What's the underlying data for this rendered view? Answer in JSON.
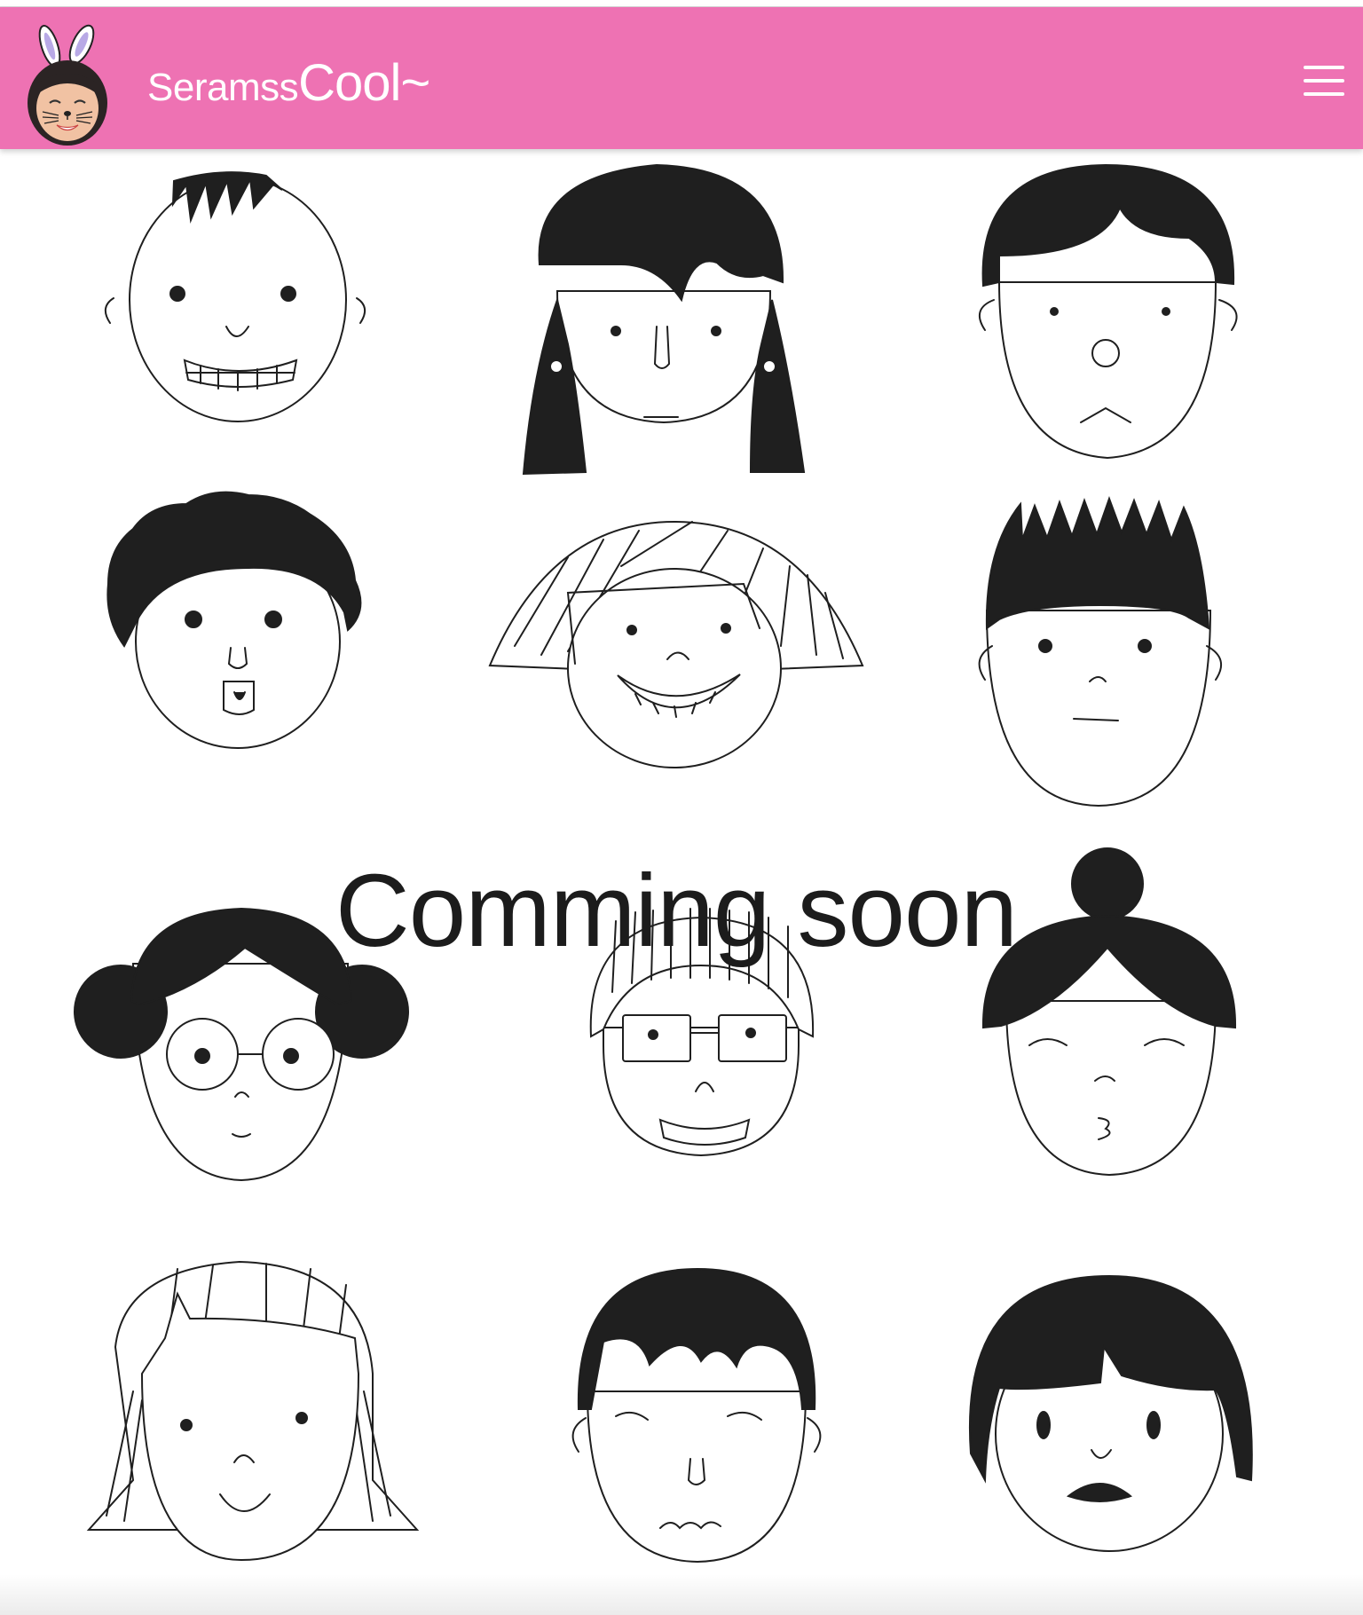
{
  "header": {
    "brand_prefix": "Seramss",
    "brand_suffix": "Cool~",
    "background_color": "#ee72b3",
    "avatar": "profile-photo-with-bunny-ears",
    "menu_icon": "hamburger-icon"
  },
  "main": {
    "message": "Comming soon",
    "illustration": "twelve-cartoon-faces-grid"
  }
}
